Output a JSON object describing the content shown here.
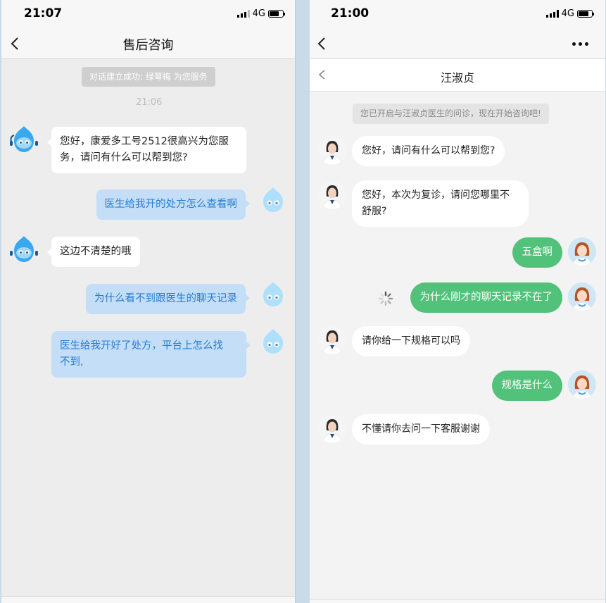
{
  "left": {
    "status": {
      "time": "21:07",
      "network": "4G"
    },
    "nav": {
      "title": "售后咨询"
    },
    "system_note": "对话建立成功: 绿萼梅 为您服务",
    "timestamp": "21:06",
    "messages": [
      {
        "from": "agent",
        "text1": "您好，康爱多工号2512很高兴为您服",
        "text2": "务，请问有什么可以帮到您?"
      },
      {
        "from": "user",
        "text": "医生给我开的处方怎么查看啊"
      },
      {
        "from": "agent",
        "text": "这边不清楚的哦"
      },
      {
        "from": "user",
        "text": "为什么看不到跟医生的聊天记录"
      },
      {
        "from": "user",
        "text1": "医生给我开好了处方，平台上怎么找",
        "text2": "不到,"
      }
    ]
  },
  "right": {
    "status": {
      "time": "21:00",
      "network": "4G"
    },
    "nav": {
      "title": "",
      "subtitle": "汪淑贞"
    },
    "system_note": "您已开启与汪淑贞医生的问诊，现在开始咨询吧!",
    "messages": [
      {
        "from": "doctor",
        "text": "您好，请问有什么可以帮到您?"
      },
      {
        "from": "doctor",
        "text1": "您好，本次为复诊，请问您哪里不",
        "text2": "舒服?"
      },
      {
        "from": "user",
        "text": "五盒啊"
      },
      {
        "from": "user",
        "text": "为什么刚才的聊天记录不在了",
        "status": "sending"
      },
      {
        "from": "doctor",
        "text": "请你给一下规格可以吗"
      },
      {
        "from": "user",
        "text": "规格是什么"
      },
      {
        "from": "doctor",
        "text": "不懂请你去问一下客服谢谢"
      }
    ]
  },
  "colors": {
    "user_blue_bubble": "#c4def7",
    "user_blue_text": "#2a7cd1",
    "user_green_bubble": "#52c179",
    "background": "#ededed"
  }
}
